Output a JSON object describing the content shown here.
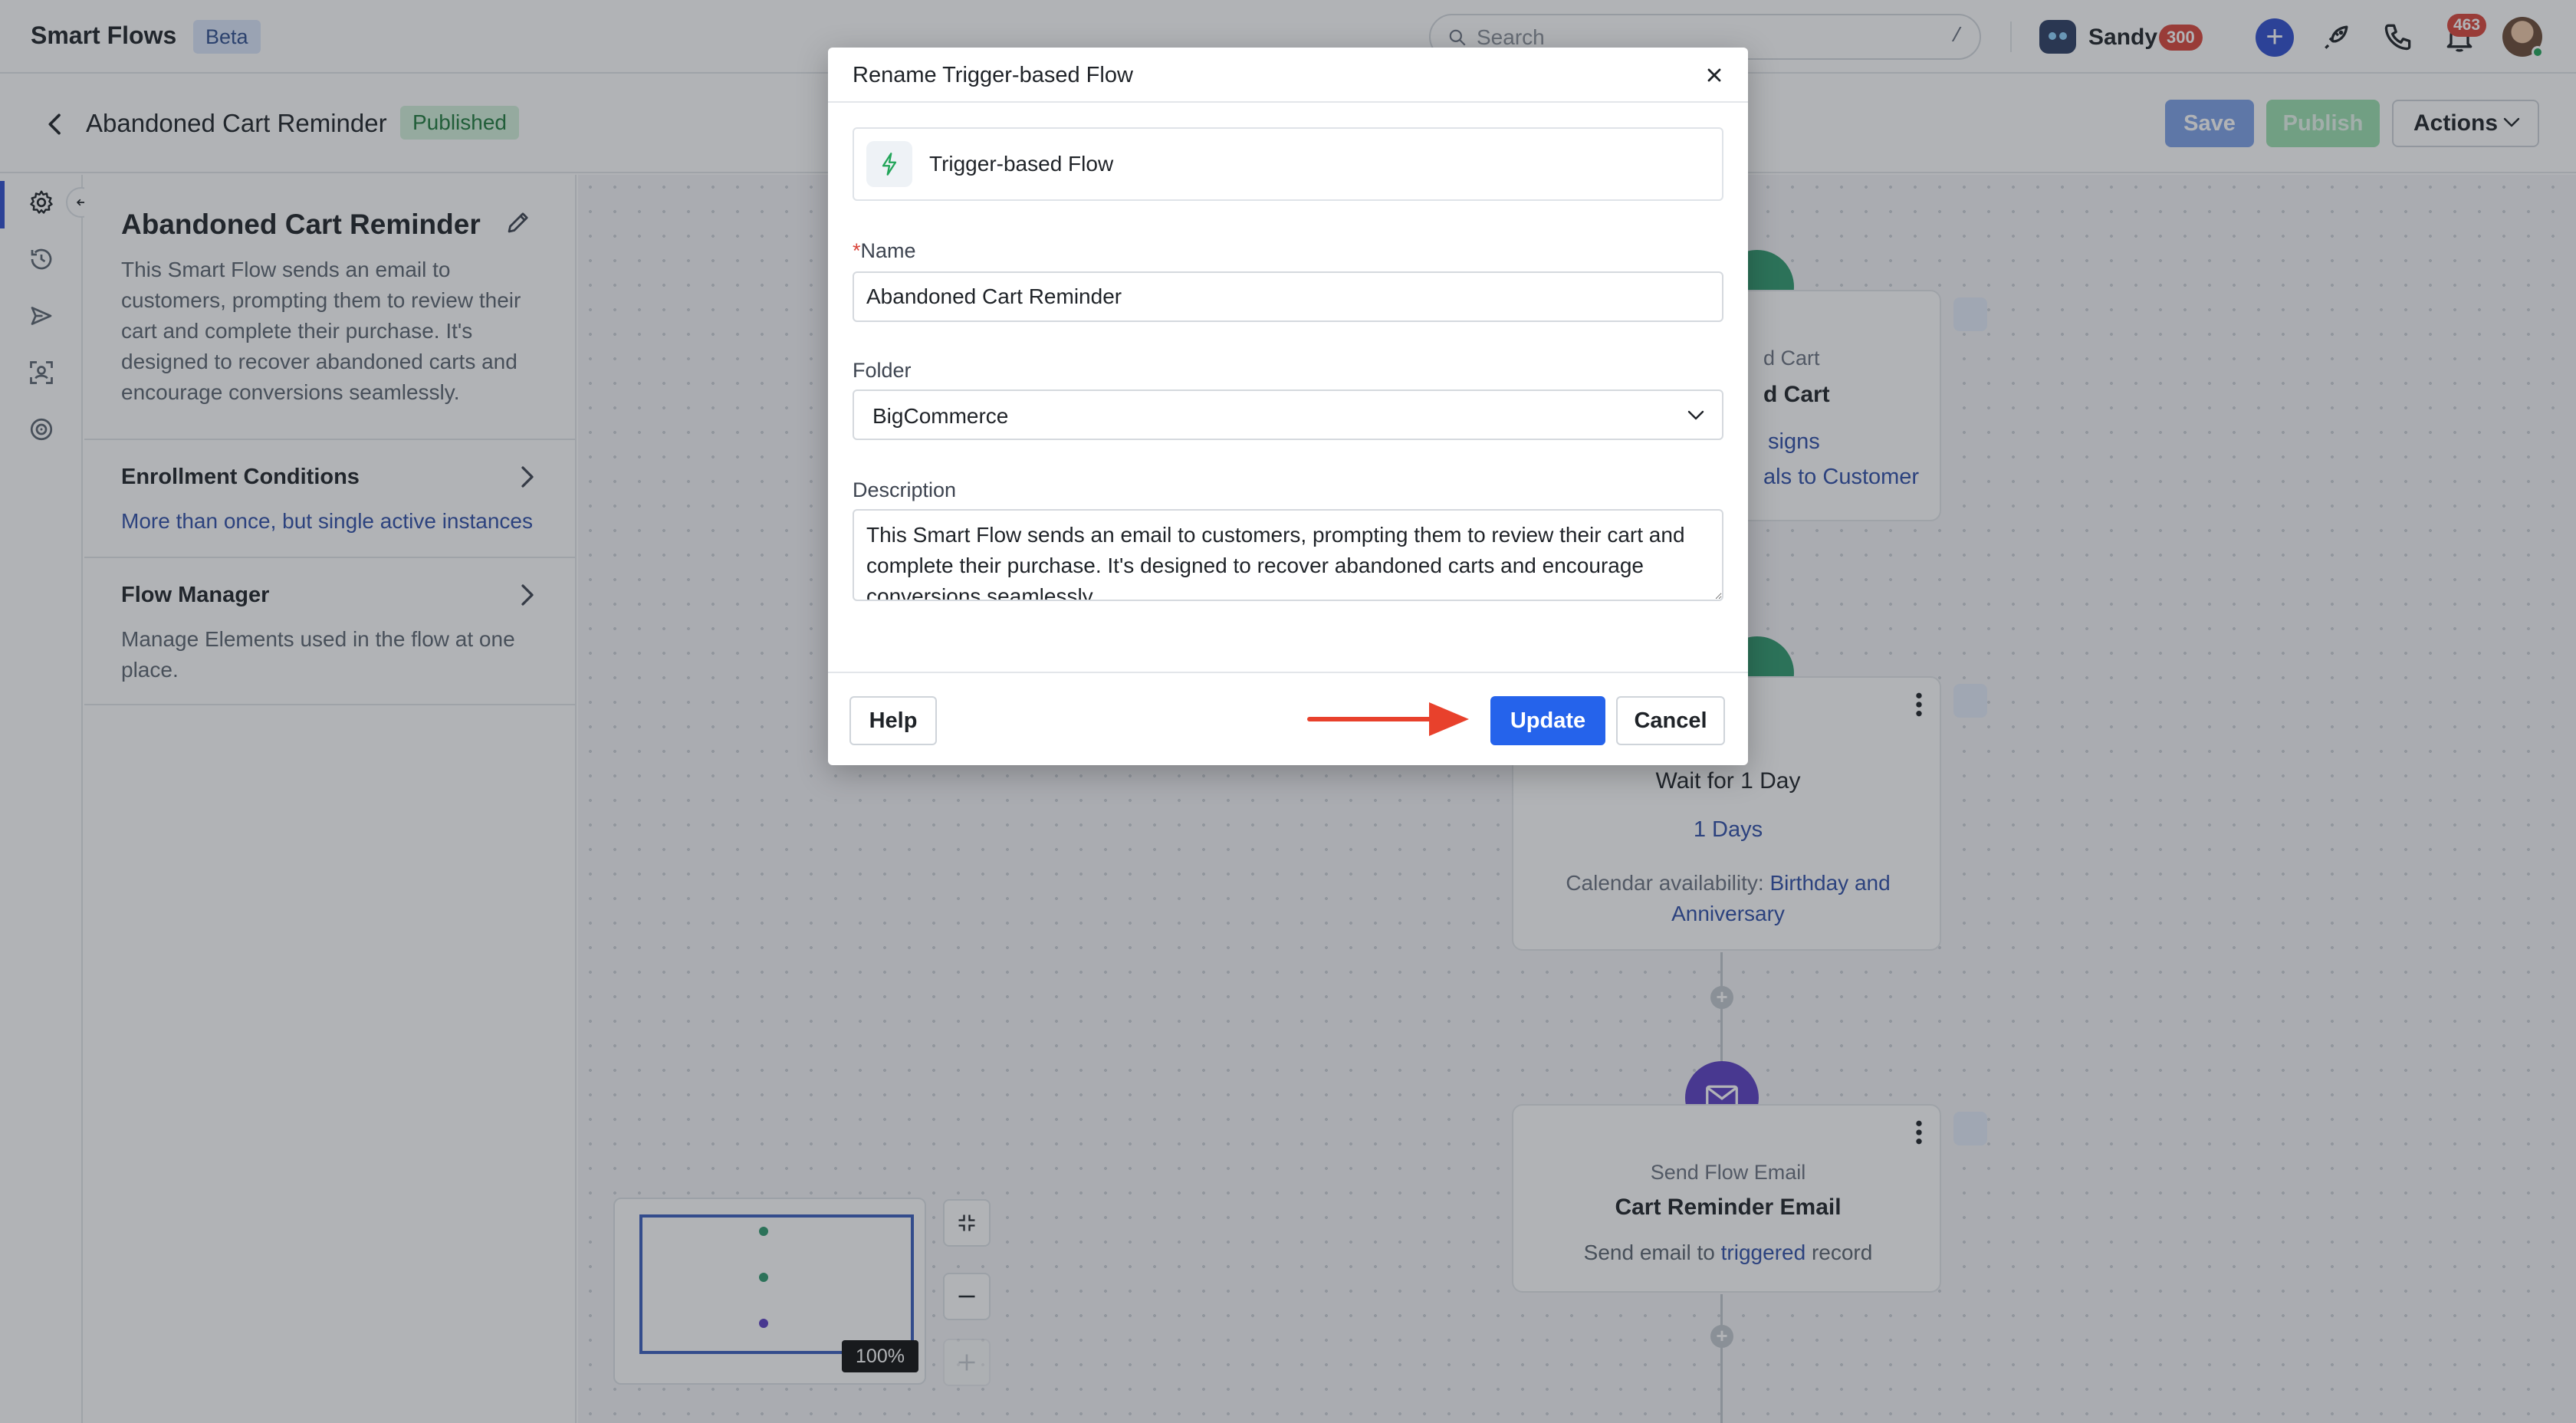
{
  "app": {
    "title": "Smart Flows",
    "badge": "Beta"
  },
  "search": {
    "placeholder": "Search",
    "shortcut": "/"
  },
  "user": {
    "name": "Sandy",
    "score": "300"
  },
  "notifications": {
    "count": "463"
  },
  "subheader": {
    "flow_title": "Abandoned Cart Reminder",
    "status": "Published",
    "save_label": "Save",
    "publish_label": "Publish",
    "actions_label": "Actions"
  },
  "panel": {
    "title": "Abandoned Cart Reminder",
    "description": "This Smart Flow sends an email to customers, prompting them to review their cart and complete their purchase. It's designed to recover abandoned carts and encourage conversions seamlessly.",
    "sections": [
      {
        "title": "Enrollment Conditions",
        "subtitle": "More than once, but single active instances"
      },
      {
        "title": "Flow Manager",
        "subtitle": "Manage Elements used in the flow at one place."
      }
    ]
  },
  "canvas": {
    "trigger_node": {
      "kind": "d Cart",
      "name": "d Cart",
      "link1": "signs",
      "link2": "als to Customer"
    },
    "wait_node": {
      "name": "Wait for 1 Day",
      "duration": "1 Days",
      "calendar_label": "Calendar availability:",
      "calendar_value": "Birthday and Anniversary"
    },
    "email_node": {
      "kind": "Send Flow Email",
      "name": "Cart Reminder Email",
      "desc_prefix": "Send email to",
      "desc_link": "triggered",
      "desc_suffix": "record"
    },
    "zoom": "100%"
  },
  "modal": {
    "title": "Rename Trigger-based Flow",
    "type_label": "Trigger-based Flow",
    "name_label": "Name",
    "name_required": "*",
    "name_value": "Abandoned Cart Reminder",
    "folder_label": "Folder",
    "folder_value": "BigCommerce",
    "description_label": "Description",
    "description_value": "This Smart Flow sends an email to customers, prompting them to review their cart and complete their purchase. It's designed to recover abandoned carts and encourage conversions seamlessly.",
    "help_label": "Help",
    "update_label": "Update",
    "cancel_label": "Cancel"
  },
  "colors": {
    "primary": "#2563eb",
    "published_bg": "#d4f1dc",
    "annotation_arrow": "#e8412c",
    "email_node": "#5b3fc4",
    "trigger_node": "#2f9a6e"
  },
  "icons": [
    "search-icon",
    "gear-icon",
    "history-icon",
    "send-icon",
    "scan-icon",
    "target-icon",
    "edit-icon",
    "chevron-right-icon",
    "chevron-down-icon",
    "close-icon",
    "lightning-icon",
    "mail-icon",
    "rocket-icon",
    "phone-icon",
    "bell-icon",
    "fit-view-icon",
    "zoom-out-icon",
    "zoom-in-icon"
  ]
}
